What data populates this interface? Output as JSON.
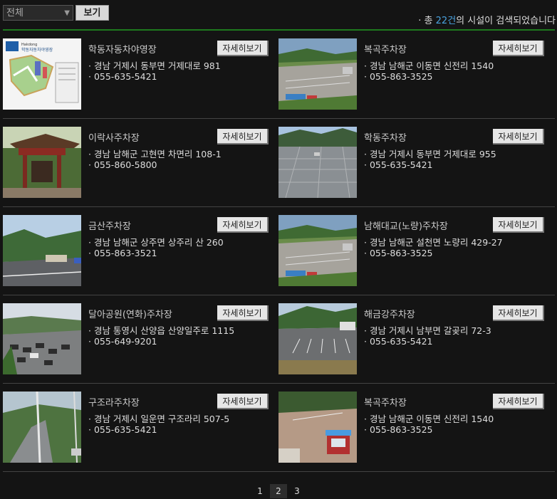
{
  "filter": {
    "selected": "전체",
    "view_label": "보기"
  },
  "result": {
    "prefix": "· 총 ",
    "count": "22건",
    "suffix": "의 시설이 검색되었습니다"
  },
  "detail_label": "자세히보기",
  "items": [
    {
      "name": "학동자동차야영장",
      "address": "· 경남 거제시 동부면 거제대로 981",
      "phone": "· 055-635-5421",
      "thumb": "map"
    },
    {
      "name": "복곡주차장",
      "address": "· 경남 남해군 이동면 신전리 1540",
      "phone": "· 055-863-3525",
      "thumb": "lot-aerial"
    },
    {
      "name": "이락사주차장",
      "address": "· 경남 남해군 고현면 차면리 108-1",
      "phone": "· 055-860-5800",
      "thumb": "pavilion"
    },
    {
      "name": "학동주차장",
      "address": "· 경남 거제시 동부면 거제대로 955",
      "phone": "· 055-635-5421",
      "thumb": "paved-lot"
    },
    {
      "name": "금산주차장",
      "address": "· 경남 남해군 상주면 상주리 산 260",
      "phone": "· 055-863-3521",
      "thumb": "road"
    },
    {
      "name": "남해대교(노량)주차장",
      "address": "· 경남 남해군 설천면 노량리 429-27",
      "phone": "· 055-863-3525",
      "thumb": "lot-aerial"
    },
    {
      "name": "달아공원(연화)주차장",
      "address": "· 경남 통영시 산양읍 산양일주로 1115",
      "phone": "· 055-649-9201",
      "thumb": "cars"
    },
    {
      "name": "해금강주차장",
      "address": "· 경남 거제시 남부면 갈곶리 72-3",
      "phone": "· 055-635-5421",
      "thumb": "empty-lot"
    },
    {
      "name": "구조라주차장",
      "address": "· 경남 거제시 일운면 구조라리 507-5",
      "phone": "· 055-635-5421",
      "thumb": "valley"
    },
    {
      "name": "복곡주차장",
      "address": "· 경남 남해군 이동면 신전리 1540",
      "phone": "· 055-863-3525",
      "thumb": "booth"
    }
  ],
  "pagination": {
    "pages": [
      "1",
      "2",
      "3"
    ],
    "current": "2"
  }
}
